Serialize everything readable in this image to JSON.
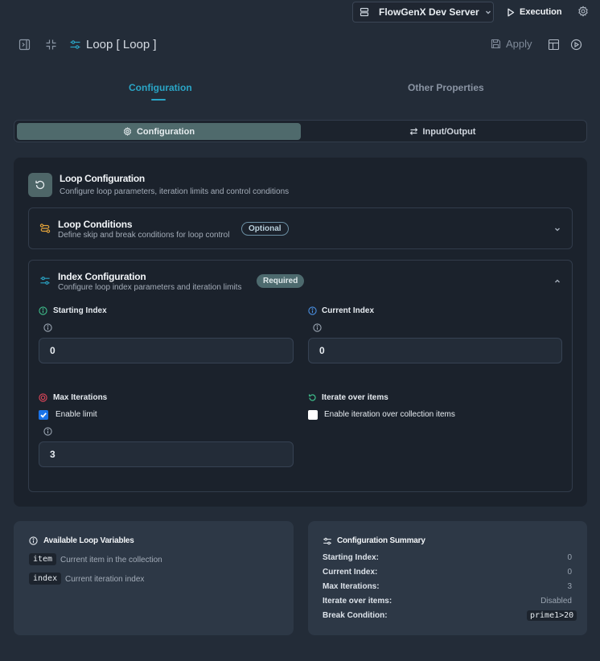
{
  "topbar": {
    "server_label": "FlowGenX Dev Server",
    "execution_label": "Execution"
  },
  "header": {
    "title": "Loop [ Loop ]",
    "apply_label": "Apply"
  },
  "tabs": [
    {
      "label": "Configuration",
      "active": true
    },
    {
      "label": "Other Properties",
      "active": false
    }
  ],
  "segmented": {
    "configuration_label": "Configuration",
    "io_label": "Input/Output"
  },
  "loop_configuration": {
    "title": "Loop Configuration",
    "subtitle": "Configure loop parameters, iteration limits and control conditions"
  },
  "loop_conditions": {
    "title": "Loop Conditions",
    "subtitle": "Define skip and break conditions for loop control",
    "badge": "Optional"
  },
  "index_configuration": {
    "title": "Index Configuration",
    "subtitle": "Configure loop index parameters and iteration limits",
    "badge": "Required",
    "starting_index": {
      "label": "Starting Index",
      "value": "0"
    },
    "current_index": {
      "label": "Current Index",
      "value": "0"
    },
    "max_iterations": {
      "label": "Max Iterations",
      "checkbox_label": "Enable limit",
      "checked": true,
      "value": "3"
    },
    "iterate_over_items": {
      "label": "Iterate over items",
      "checkbox_label": "Enable iteration over collection items",
      "checked": false
    }
  },
  "loop_variables": {
    "title": "Available Loop Variables",
    "items": [
      {
        "name": "item",
        "description": "Current item in the collection"
      },
      {
        "name": "index",
        "description": "Current iteration index"
      }
    ]
  },
  "summary": {
    "title": "Configuration Summary",
    "rows": [
      {
        "key": "Starting Index:",
        "value": "0"
      },
      {
        "key": "Current Index:",
        "value": "0"
      },
      {
        "key": "Max Iterations:",
        "value": "3"
      },
      {
        "key": "Iterate over items:",
        "value": "Disabled"
      },
      {
        "key": "Break Condition:",
        "value": "prime1>20"
      }
    ]
  },
  "colors": {
    "accent": "#2aa5c6",
    "background": "#232c38",
    "card": "#1b222c",
    "badge_required": "#4d6a6e",
    "checkbox": "#1a73e8"
  }
}
